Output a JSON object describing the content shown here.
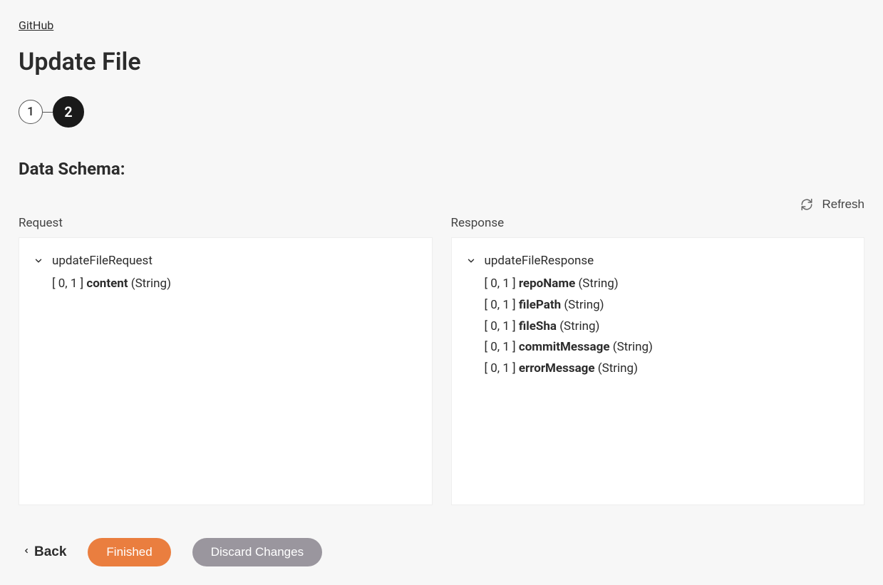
{
  "breadcrumb": {
    "label": "GitHub"
  },
  "page": {
    "title": "Update File"
  },
  "stepper": {
    "steps": [
      "1",
      "2"
    ],
    "active_index": 1
  },
  "section": {
    "title": "Data Schema:"
  },
  "refresh": {
    "label": "Refresh"
  },
  "panels": {
    "request": {
      "label": "Request",
      "root": "updateFileRequest",
      "fields": [
        {
          "cardinality": "[ 0, 1 ]",
          "name": "content",
          "type": "(String)"
        }
      ]
    },
    "response": {
      "label": "Response",
      "root": "updateFileResponse",
      "fields": [
        {
          "cardinality": "[ 0, 1 ]",
          "name": "repoName",
          "type": "(String)"
        },
        {
          "cardinality": "[ 0, 1 ]",
          "name": "filePath",
          "type": "(String)"
        },
        {
          "cardinality": "[ 0, 1 ]",
          "name": "fileSha",
          "type": "(String)"
        },
        {
          "cardinality": "[ 0, 1 ]",
          "name": "commitMessage",
          "type": "(String)"
        },
        {
          "cardinality": "[ 0, 1 ]",
          "name": "errorMessage",
          "type": "(String)"
        }
      ]
    }
  },
  "footer": {
    "back": "Back",
    "finished": "Finished",
    "discard": "Discard Changes"
  }
}
